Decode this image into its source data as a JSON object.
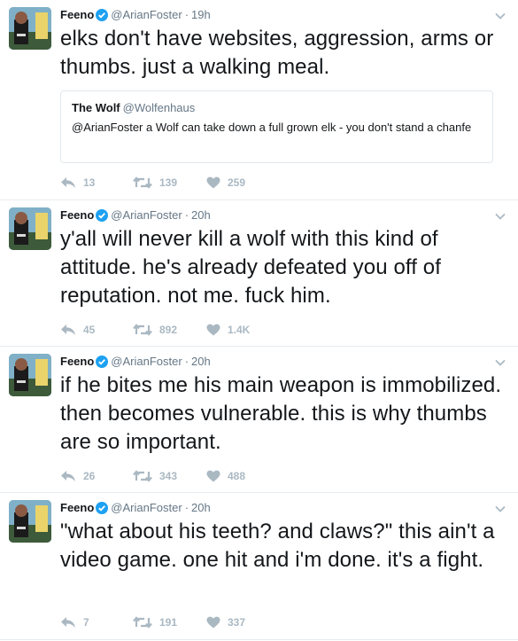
{
  "colors": {
    "verified": "#1da1f2",
    "action_icon": "#aab8c2",
    "secondary_text": "#657786",
    "divider": "#e6ecf0"
  },
  "icons": {
    "reply": "reply-icon",
    "retweet": "retweet-icon",
    "like": "heart-icon",
    "verified": "verified-badge-icon",
    "menu": "chevron-down-icon"
  },
  "tweets": [
    {
      "name": "Feeno",
      "handle": "@ArianFoster",
      "time": "19h",
      "text": "elks don't have websites, aggression, arms or thumbs. just a walking meal.",
      "quote": {
        "name": "The Wolf",
        "handle": "@Wolfenhaus",
        "text": "@ArianFoster a Wolf can take down a full grown elk - you don't stand a chanfe"
      },
      "replies": "13",
      "retweets": "139",
      "likes": "259"
    },
    {
      "name": "Feeno",
      "handle": "@ArianFoster",
      "time": "20h",
      "text": "y'all will never kill a wolf with this kind of attitude. he's already defeated you off of reputation. not me. fuck him.",
      "replies": "45",
      "retweets": "892",
      "likes": "1.4K"
    },
    {
      "name": "Feeno",
      "handle": "@ArianFoster",
      "time": "20h",
      "text": "if he bites me his main weapon is immobilized. then becomes vulnerable. this is why thumbs are so important.",
      "replies": "26",
      "retweets": "343",
      "likes": "488"
    },
    {
      "name": "Feeno",
      "handle": "@ArianFoster",
      "time": "20h",
      "text": "\"what about his teeth? and claws?\" this ain't a video game. one hit and i'm done. it's a fight.",
      "replies": "7",
      "retweets": "191",
      "likes": "337"
    }
  ]
}
